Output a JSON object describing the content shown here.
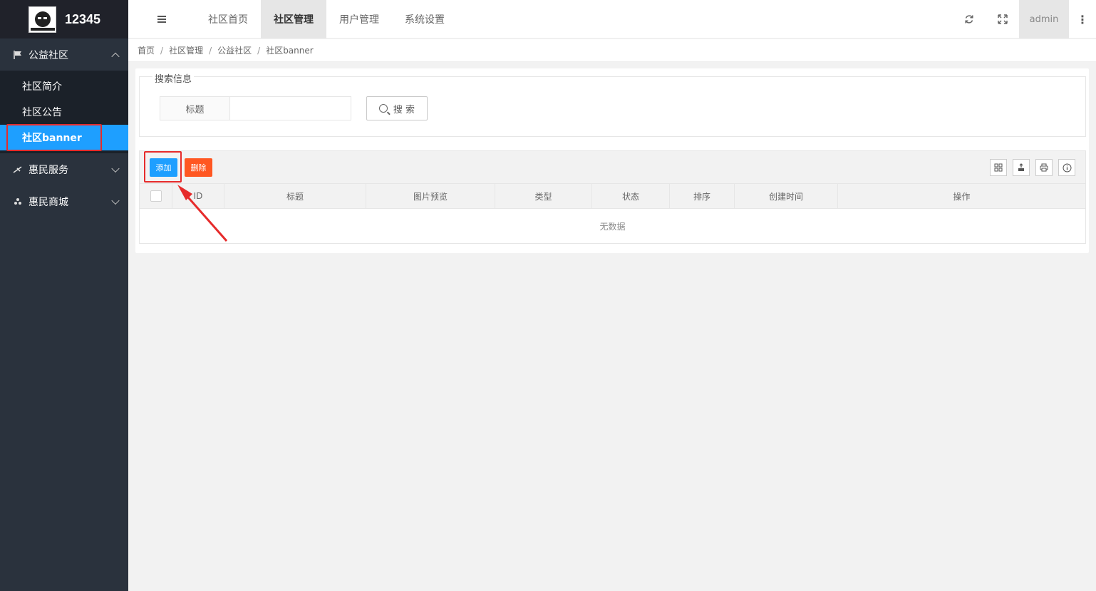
{
  "app": {
    "logo_text": "12345"
  },
  "sidebar": {
    "groups": [
      {
        "label": "公益社区",
        "icon": "flag-icon",
        "open": true,
        "items": [
          {
            "label": "社区简介"
          },
          {
            "label": "社区公告"
          },
          {
            "label": "社区banner",
            "active": true
          }
        ]
      },
      {
        "label": "惠民服务",
        "icon": "tool-icon",
        "open": false
      },
      {
        "label": "惠民商城",
        "icon": "shop-icon",
        "open": false
      }
    ]
  },
  "header": {
    "tabs": [
      {
        "label": "社区首页"
      },
      {
        "label": "社区管理",
        "active": true
      },
      {
        "label": "用户管理"
      },
      {
        "label": "系统设置"
      }
    ],
    "user": "admin",
    "more": "⋮"
  },
  "breadcrumb": [
    "首页",
    "社区管理",
    "公益社区",
    "社区banner"
  ],
  "breadcrumb_sep": "/",
  "search": {
    "legend": "搜索信息",
    "field_label": "标题",
    "field_value": "",
    "button_label": "搜 索"
  },
  "toolbar": {
    "add_label": "添加",
    "delete_label": "删除"
  },
  "table": {
    "columns": [
      "ID",
      "标题",
      "图片预览",
      "类型",
      "状态",
      "排序",
      "创建时间",
      "操作"
    ],
    "empty_text": "无数据"
  },
  "colors": {
    "sidebar_bg": "#2a323d",
    "active": "#1e9fff",
    "danger": "#ff5722",
    "annotation": "#e62b2b"
  }
}
